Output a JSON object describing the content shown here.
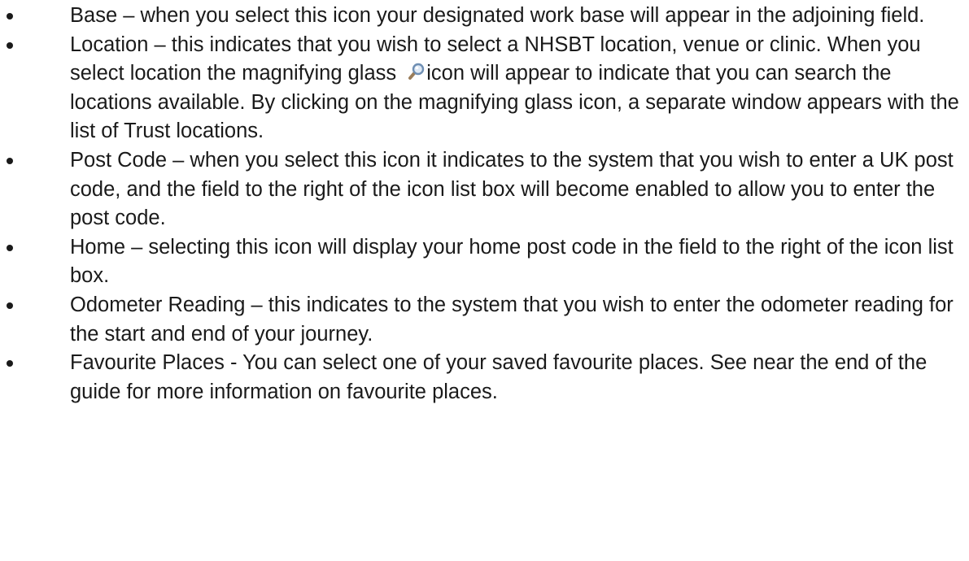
{
  "bullets": [
    {
      "text": "Base – when you select this icon your designated work base will appear in the adjoining field."
    },
    {
      "text_before_icon": "Location – this indicates that you wish to select a NHSBT location, venue or clinic.  When you select location the magnifying glass ",
      "icon": "magnifying-glass-icon",
      "text_after_icon": "icon will appear to indicate that you can search the locations available.  By clicking on the magnifying glass icon, a separate window appears with the list of Trust locations."
    },
    {
      "text": "Post Code – when you select this icon it indicates to the system that you wish to enter a UK post code, and the field to the right of the icon list box will become enabled to allow you to enter the post code."
    },
    {
      "text": "Home – selecting this icon will display your home post code in the field to the right of the icon list box."
    },
    {
      "text": "Odometer Reading – this indicates to the system that you wish to enter the odometer reading for the start and end of your journey."
    },
    {
      "text": "Favourite Places - You can select one of your saved favourite places. See near the end of the guide for more information on favourite places."
    }
  ],
  "colors": {
    "text": "#1a1a1a",
    "icon_handle": "#9a7d5a",
    "icon_lens": "#6f8fb3"
  }
}
